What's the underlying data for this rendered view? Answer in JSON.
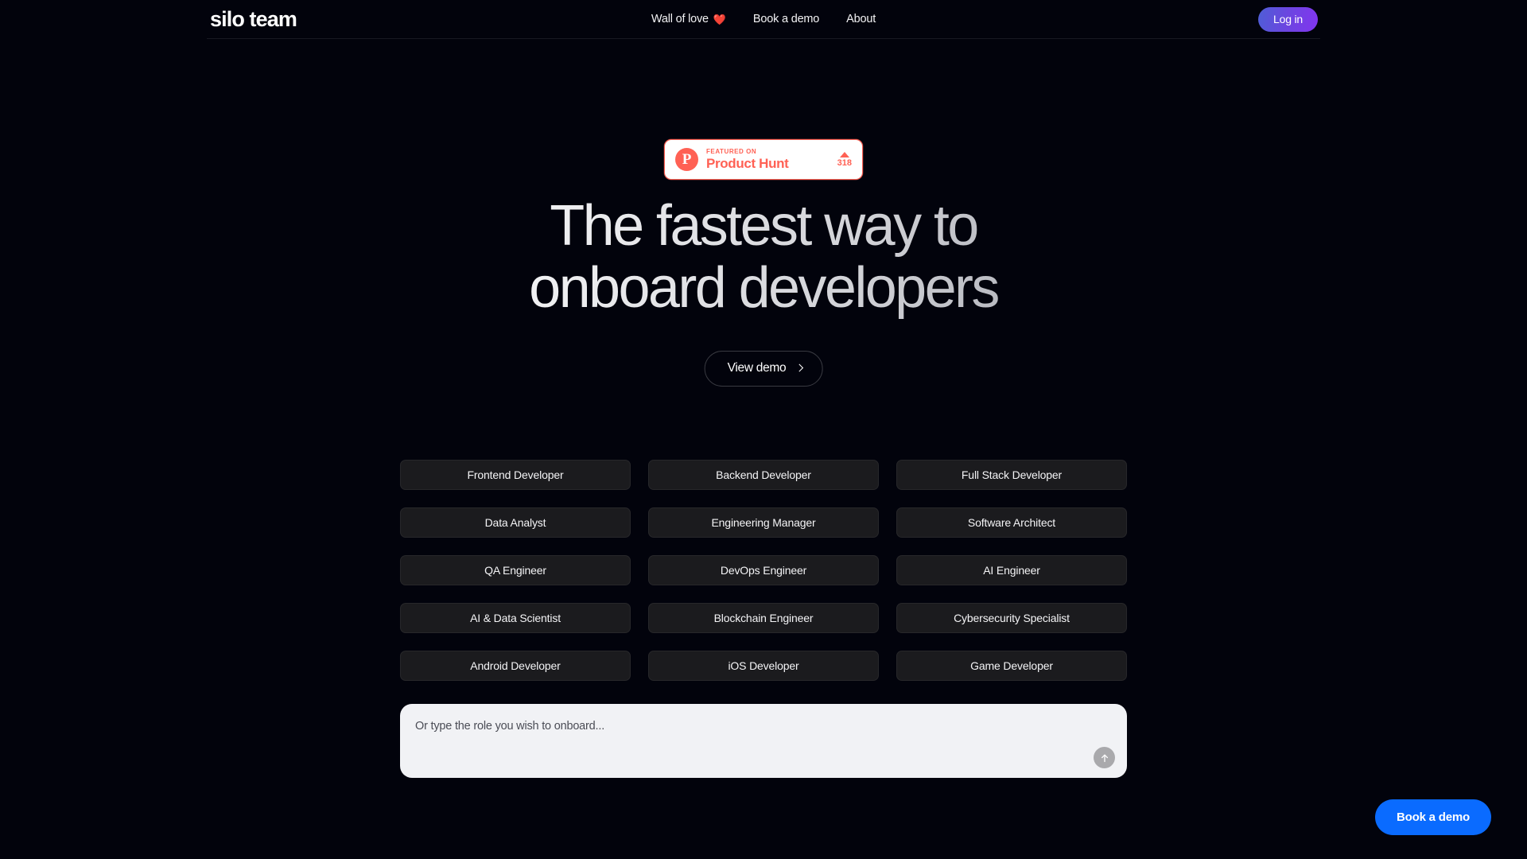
{
  "colors": {
    "background": "#02030c",
    "card": "#1b1b1e",
    "product_hunt": "#ff6154",
    "cta_blue": "#0a6bff",
    "login_gradient_start": "#4e5ed6",
    "login_gradient_end": "#8235ef",
    "composer_bg": "#f1f2f5"
  },
  "header": {
    "logo": "silo team",
    "nav": [
      {
        "label": "Wall of love",
        "icon": "heart-icon",
        "emoji": "❤️"
      },
      {
        "label": "Book a demo",
        "icon": null,
        "emoji": ""
      },
      {
        "label": "About",
        "icon": null,
        "emoji": ""
      }
    ],
    "login_label": "Log in"
  },
  "hero": {
    "badge": {
      "logo_letter": "P",
      "featured_on": "FEATURED ON",
      "product_name": "Product Hunt",
      "upvote_count": "318"
    },
    "headline_line_1": "The fastest way to",
    "headline_line_2": "onboard developers",
    "view_demo_label": "View demo"
  },
  "roles": [
    "Frontend Developer",
    "Backend Developer",
    "Full Stack Developer",
    "Data Analyst",
    "Engineering Manager",
    "Software Architect",
    "QA Engineer",
    "DevOps Engineer",
    "AI Engineer",
    "AI & Data Scientist",
    "Blockchain Engineer",
    "Cybersecurity Specialist",
    "Android Developer",
    "iOS Developer",
    "Game Developer"
  ],
  "composer": {
    "placeholder": "Or type the role you wish to onboard...",
    "value": "",
    "send_icon": "arrow-up-icon"
  },
  "floating_cta": {
    "label": "Book a demo"
  }
}
